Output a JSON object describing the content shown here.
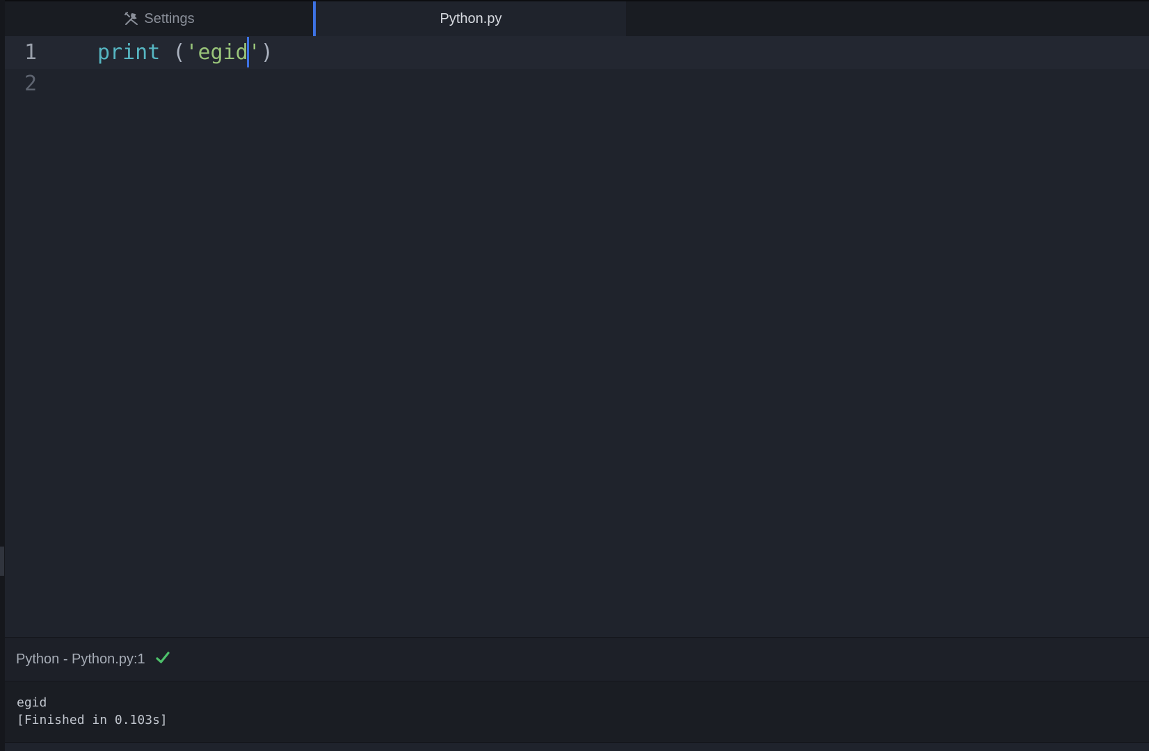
{
  "tabs": [
    {
      "label": "Settings",
      "icon": "tools-icon",
      "active": false
    },
    {
      "label": "Python.py",
      "active": true
    }
  ],
  "editor": {
    "lines": [
      {
        "number": "1",
        "tokens": {
          "fn": "print",
          "space": " ",
          "open": "(",
          "str_a": "'egid",
          "str_b": "'",
          "close": ")"
        }
      },
      {
        "number": "2"
      }
    ],
    "cursor_color": "#3d72e3"
  },
  "panel": {
    "header": "Python - Python.py:1",
    "status_icon": "check-icon",
    "status_color": "#4ec16b",
    "output_lines": [
      "egid",
      "[Finished in 0.103s]"
    ]
  },
  "colors": {
    "background": "#1f232c",
    "tab_accent": "#3d72e3",
    "function": "#56b6c2",
    "string": "#98c379"
  }
}
